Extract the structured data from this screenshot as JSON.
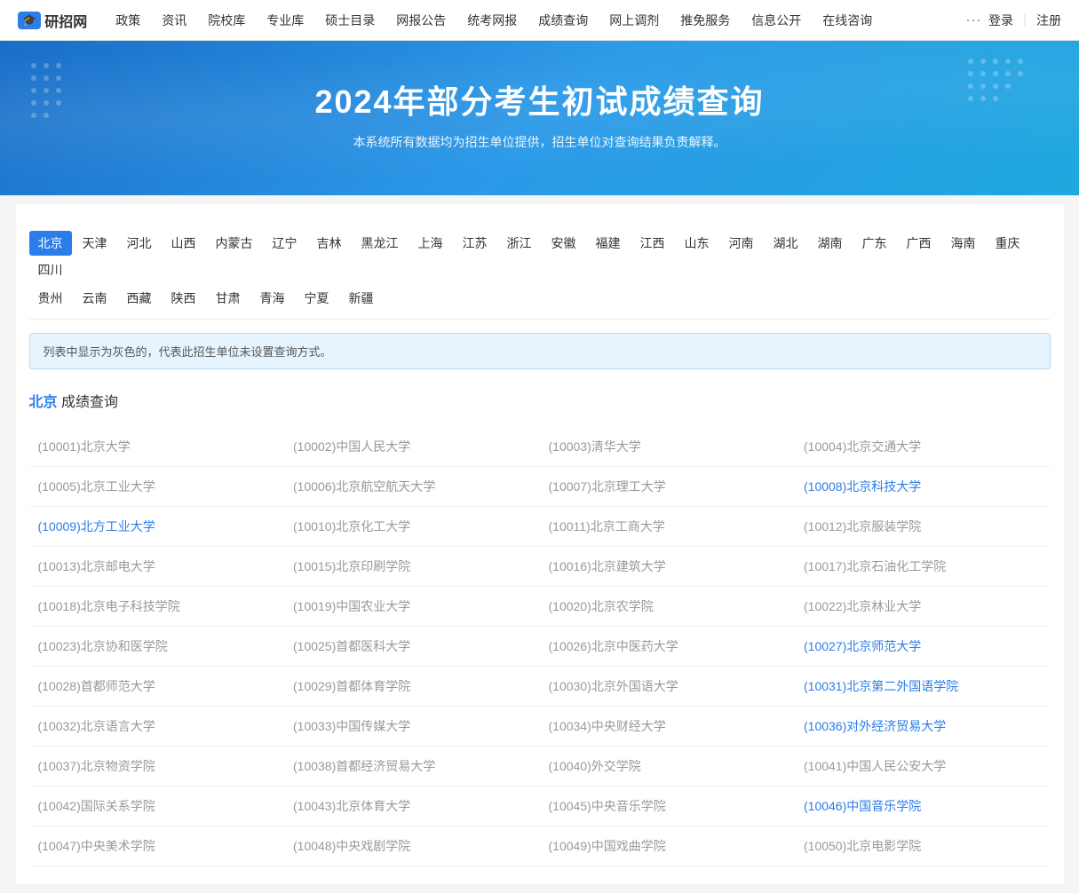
{
  "navbar": {
    "logo_icon": "🎓",
    "logo_text": "研招网",
    "nav_items": [
      {
        "label": "政策",
        "href": "#"
      },
      {
        "label": "资讯",
        "href": "#"
      },
      {
        "label": "院校库",
        "href": "#"
      },
      {
        "label": "专业库",
        "href": "#"
      },
      {
        "label": "硕士目录",
        "href": "#"
      },
      {
        "label": "网报公告",
        "href": "#"
      },
      {
        "label": "统考网报",
        "href": "#"
      },
      {
        "label": "成绩查询",
        "href": "#"
      },
      {
        "label": "网上调剂",
        "href": "#"
      },
      {
        "label": "推免服务",
        "href": "#"
      },
      {
        "label": "信息公开",
        "href": "#"
      },
      {
        "label": "在线咨询",
        "href": "#"
      }
    ],
    "more": "···",
    "login": "登录",
    "divider": "｜",
    "register": "注册"
  },
  "hero": {
    "title": "2024年部分考生初试成绩查询",
    "subtitle": "本系统所有数据均为招生单位提供，招生单位对查询结果负责解释。"
  },
  "regions_row1": [
    {
      "label": "北京",
      "active": true
    },
    {
      "label": "天津"
    },
    {
      "label": "河北"
    },
    {
      "label": "山西"
    },
    {
      "label": "内蒙古"
    },
    {
      "label": "辽宁"
    },
    {
      "label": "吉林"
    },
    {
      "label": "黑龙江"
    },
    {
      "label": "上海"
    },
    {
      "label": "江苏"
    },
    {
      "label": "浙江"
    },
    {
      "label": "安徽"
    },
    {
      "label": "福建"
    },
    {
      "label": "江西"
    },
    {
      "label": "山东"
    },
    {
      "label": "河南"
    },
    {
      "label": "湖北"
    },
    {
      "label": "湖南"
    },
    {
      "label": "广东"
    },
    {
      "label": "广西"
    },
    {
      "label": "海南"
    },
    {
      "label": "重庆"
    },
    {
      "label": "四川"
    }
  ],
  "regions_row2": [
    {
      "label": "贵州"
    },
    {
      "label": "云南"
    },
    {
      "label": "西藏"
    },
    {
      "label": "陕西"
    },
    {
      "label": "甘肃"
    },
    {
      "label": "青海"
    },
    {
      "label": "宁夏"
    },
    {
      "label": "新疆"
    }
  ],
  "notice": "列表中显示为灰色的，代表此招生单位未设置查询方式。",
  "section": {
    "prefix": "北京",
    "suffix": " 成绩查询"
  },
  "universities": [
    [
      {
        "code": "10001",
        "name": "北京大学",
        "link": false
      },
      {
        "code": "10002",
        "name": "中国人民大学",
        "link": false
      },
      {
        "code": "10003",
        "name": "清华大学",
        "link": false
      },
      {
        "code": "10004",
        "name": "北京交通大学",
        "link": false
      }
    ],
    [
      {
        "code": "10005",
        "name": "北京工业大学",
        "link": false
      },
      {
        "code": "10006",
        "name": "北京航空航天大学",
        "link": false
      },
      {
        "code": "10007",
        "name": "北京理工大学",
        "link": false
      },
      {
        "code": "10008",
        "name": "北京科技大学",
        "link": true
      }
    ],
    [
      {
        "code": "10009",
        "name": "北方工业大学",
        "link": true
      },
      {
        "code": "10010",
        "name": "北京化工大学",
        "link": false
      },
      {
        "code": "10011",
        "name": "北京工商大学",
        "link": false
      },
      {
        "code": "10012",
        "name": "北京服装学院",
        "link": false
      }
    ],
    [
      {
        "code": "10013",
        "name": "北京邮电大学",
        "link": false
      },
      {
        "code": "10015",
        "name": "北京印刷学院",
        "link": false
      },
      {
        "code": "10016",
        "name": "北京建筑大学",
        "link": false
      },
      {
        "code": "10017",
        "name": "北京石油化工学院",
        "link": false
      }
    ],
    [
      {
        "code": "10018",
        "name": "北京电子科技学院",
        "link": false
      },
      {
        "code": "10019",
        "name": "中国农业大学",
        "link": false
      },
      {
        "code": "10020",
        "name": "北京农学院",
        "link": false
      },
      {
        "code": "10022",
        "name": "北京林业大学",
        "link": false
      }
    ],
    [
      {
        "code": "10023",
        "name": "北京协和医学院",
        "link": false
      },
      {
        "code": "10025",
        "name": "首都医科大学",
        "link": false
      },
      {
        "code": "10026",
        "name": "北京中医药大学",
        "link": false
      },
      {
        "code": "10027",
        "name": "北京师范大学",
        "link": true
      }
    ],
    [
      {
        "code": "10028",
        "name": "首都师范大学",
        "link": false
      },
      {
        "code": "10029",
        "name": "首都体育学院",
        "link": false
      },
      {
        "code": "10030",
        "name": "北京外国语大学",
        "link": false
      },
      {
        "code": "10031",
        "name": "北京第二外国语学院",
        "link": true
      }
    ],
    [
      {
        "code": "10032",
        "name": "北京语言大学",
        "link": false
      },
      {
        "code": "10033",
        "name": "中国传媒大学",
        "link": false
      },
      {
        "code": "10034",
        "name": "中央财经大学",
        "link": false
      },
      {
        "code": "10036",
        "name": "对外经济贸易大学",
        "link": true
      }
    ],
    [
      {
        "code": "10037",
        "name": "北京物资学院",
        "link": false
      },
      {
        "code": "10038",
        "name": "首都经济贸易大学",
        "link": false
      },
      {
        "code": "10040",
        "name": "外交学院",
        "link": false
      },
      {
        "code": "10041",
        "name": "中国人民公安大学",
        "link": false
      }
    ],
    [
      {
        "code": "10042",
        "name": "国际关系学院",
        "link": false
      },
      {
        "code": "10043",
        "name": "北京体育大学",
        "link": false
      },
      {
        "code": "10045",
        "name": "中央音乐学院",
        "link": false
      },
      {
        "code": "10046",
        "name": "中国音乐学院",
        "link": true
      }
    ],
    [
      {
        "code": "10047",
        "name": "中央美术学院",
        "link": false
      },
      {
        "code": "10048",
        "name": "中央戏剧学院",
        "link": false
      },
      {
        "code": "10049",
        "name": "中国戏曲学院",
        "link": false
      },
      {
        "code": "10050",
        "name": "北京电影学院",
        "link": false
      }
    ]
  ]
}
